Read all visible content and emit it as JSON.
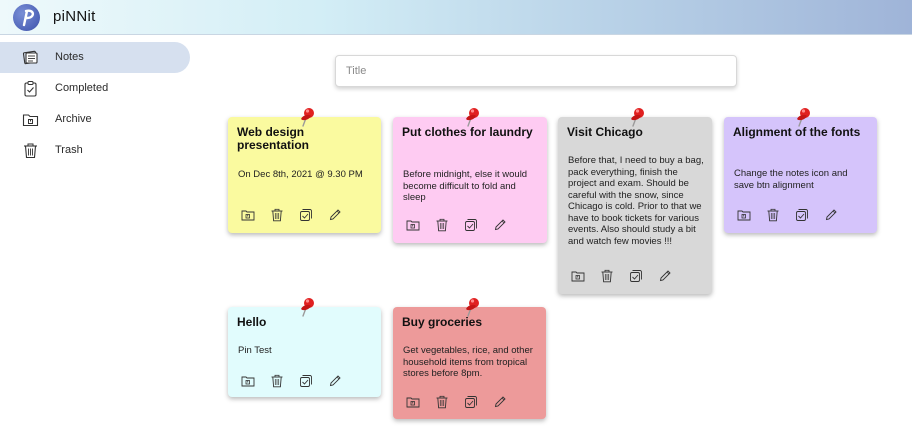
{
  "app": {
    "title": "piNNit",
    "logo_letter": "P"
  },
  "sidebar": {
    "items": [
      {
        "label": "Notes",
        "icon": "notes-icon",
        "active": true
      },
      {
        "label": "Completed",
        "icon": "clipboard-check-icon",
        "active": false
      },
      {
        "label": "Archive",
        "icon": "archive-folder-icon",
        "active": false
      },
      {
        "label": "Trash",
        "icon": "trash-icon",
        "active": false
      }
    ]
  },
  "search": {
    "placeholder": "Title",
    "value": ""
  },
  "notes": [
    {
      "title": "Web design presentation",
      "body": "On Dec 8th, 2021 @ 9.30 PM",
      "color": "#fafa9f"
    },
    {
      "title": "Put clothes for laundry",
      "body": "Before midnight, else it would become difficult to fold and sleep",
      "color": "#fecbf2"
    },
    {
      "title": "Visit Chicago",
      "body": "Before that, I need to buy a bag, pack everything, finish the project and exam. Should be careful with the snow, since Chicago is cold. Prior to that we have to book tickets for various events. Also should study a bit and watch few movies !!!",
      "color": "#d8d8d8"
    },
    {
      "title": "Alignment of the fonts",
      "body": "Change the notes icon and save btn alignment",
      "color": "#d5c4fb"
    },
    {
      "title": "Hello",
      "body": "Pin Test",
      "color": "#e1fcfd"
    },
    {
      "title": "Buy groceries",
      "body": "Get vegetables, rice, and other household items from tropical stores before 8pm.",
      "color": "#ed9a9a"
    }
  ],
  "note_actions": [
    "archive-icon",
    "trash-icon",
    "complete-icon",
    "edit-icon"
  ],
  "pin_icon": "pushpin-icon"
}
